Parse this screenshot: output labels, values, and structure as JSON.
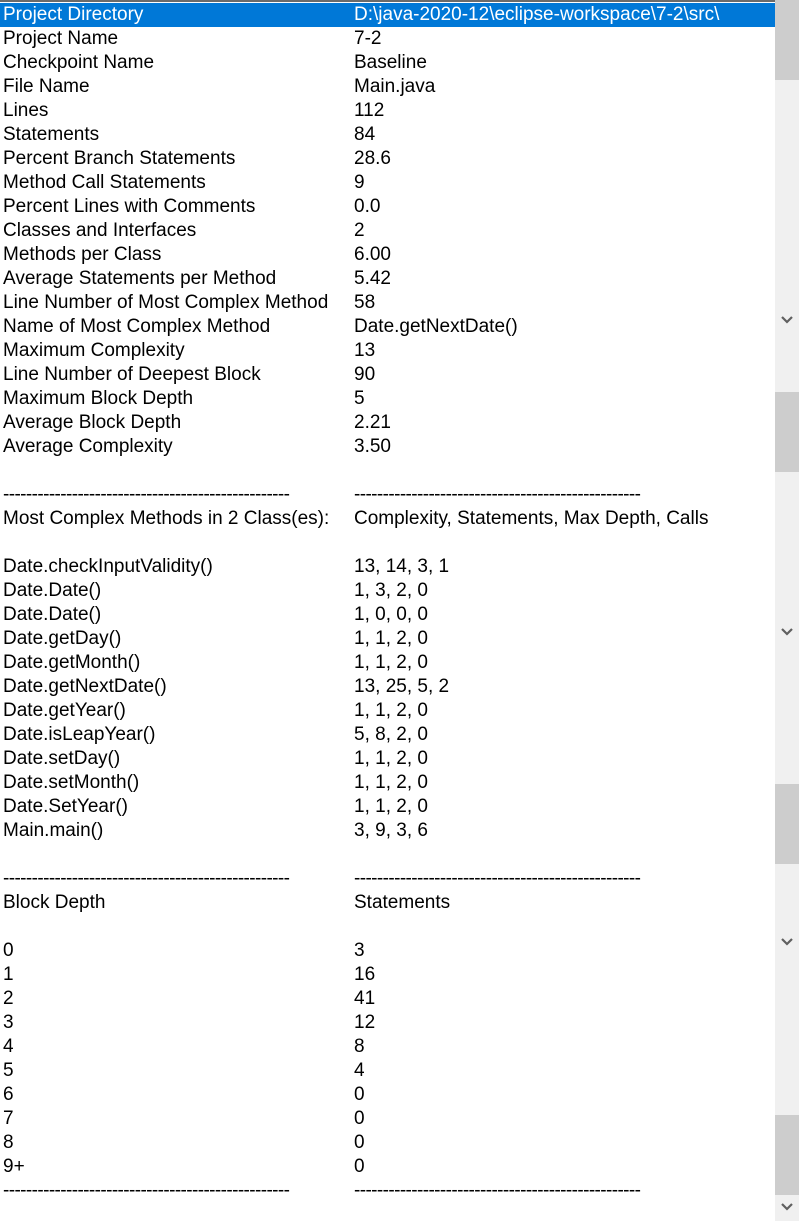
{
  "selected_row_index": 0,
  "summary": [
    {
      "label": "Project Directory",
      "value": "D:\\java-2020-12\\eclipse-workspace\\7-2\\src\\"
    },
    {
      "label": "Project Name",
      "value": "7-2"
    },
    {
      "label": "Checkpoint Name",
      "value": "Baseline"
    },
    {
      "label": "File Name",
      "value": "Main.java"
    },
    {
      "label": "Lines",
      "value": "112"
    },
    {
      "label": "Statements",
      "value": "84"
    },
    {
      "label": "Percent Branch Statements",
      "value": "28.6"
    },
    {
      "label": "Method Call Statements",
      "value": "9"
    },
    {
      "label": "Percent Lines with Comments",
      "value": "0.0"
    },
    {
      "label": "Classes and Interfaces",
      "value": "2"
    },
    {
      "label": "Methods per Class",
      "value": "6.00"
    },
    {
      "label": "Average Statements per Method",
      "value": "5.42"
    },
    {
      "label": "Line Number of Most Complex Method",
      "value": "58"
    },
    {
      "label": "Name of Most Complex Method",
      "value": "Date.getNextDate()"
    },
    {
      "label": "Maximum Complexity",
      "value": "13"
    },
    {
      "label": "Line Number of Deepest Block",
      "value": "90"
    },
    {
      "label": "Maximum Block Depth",
      "value": "5"
    },
    {
      "label": "Average Block Depth",
      "value": "2.21"
    },
    {
      "label": "Average Complexity",
      "value": "3.50"
    }
  ],
  "separator": "--------------------------------------------------",
  "methods_section": {
    "header_left": "Most Complex Methods in 2 Class(es):",
    "header_right": "Complexity, Statements, Max Depth, Calls",
    "rows": [
      {
        "method": "Date.checkInputValidity()",
        "metrics": "13, 14, 3, 1"
      },
      {
        "method": "Date.Date()",
        "metrics": "1, 3, 2, 0"
      },
      {
        "method": "Date.Date()",
        "metrics": "1, 0, 0, 0"
      },
      {
        "method": "Date.getDay()",
        "metrics": "1, 1, 2, 0"
      },
      {
        "method": "Date.getMonth()",
        "metrics": "1, 1, 2, 0"
      },
      {
        "method": "Date.getNextDate()",
        "metrics": "13, 25, 5, 2"
      },
      {
        "method": "Date.getYear()",
        "metrics": "1, 1, 2, 0"
      },
      {
        "method": "Date.isLeapYear()",
        "metrics": "5, 8, 2, 0"
      },
      {
        "method": "Date.setDay()",
        "metrics": "1, 1, 2, 0"
      },
      {
        "method": "Date.setMonth()",
        "metrics": "1, 1, 2, 0"
      },
      {
        "method": "Date.SetYear()",
        "metrics": "1, 1, 2, 0"
      },
      {
        "method": "Main.main()",
        "metrics": "3, 9, 3, 6"
      }
    ]
  },
  "block_depth_section": {
    "header_left": "Block Depth",
    "header_right": "Statements",
    "rows": [
      {
        "depth": "0",
        "statements": "3"
      },
      {
        "depth": "1",
        "statements": "16"
      },
      {
        "depth": "2",
        "statements": "41"
      },
      {
        "depth": "3",
        "statements": "12"
      },
      {
        "depth": "4",
        "statements": "8"
      },
      {
        "depth": "5",
        "statements": "4"
      },
      {
        "depth": "6",
        "statements": "0"
      },
      {
        "depth": "7",
        "statements": "0"
      },
      {
        "depth": "8",
        "statements": "0"
      },
      {
        "depth": "9+",
        "statements": "0"
      }
    ]
  },
  "icons": {
    "scroll_arrow": "chevron-down-icon"
  },
  "colors": {
    "selection": "#0078d7",
    "scroll_track": "#f0f0f0",
    "scroll_thumb": "#cdcdcd",
    "arrow": "#606060"
  }
}
